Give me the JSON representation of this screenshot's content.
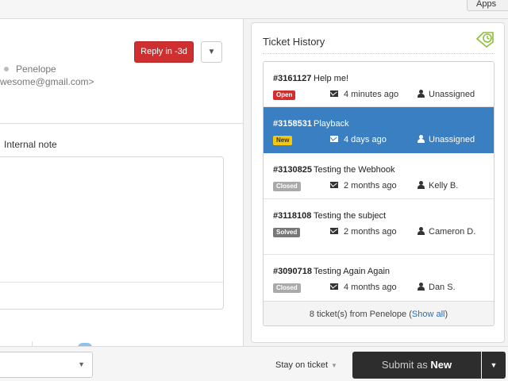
{
  "topbar": {
    "apps_label": "Apps"
  },
  "main": {
    "reply_button": "Reply in -3d",
    "reply_menu_icon": "chevron-down-icon",
    "requester_name": "Penelope",
    "requester_email": "wesome@gmail.com>",
    "internal_note_label": "Internal note"
  },
  "history": {
    "title": "Ticket History",
    "icon": "clock-tag-icon",
    "tickets": [
      {
        "number": "#3161127",
        "subject": "Help me!",
        "status": "Open",
        "time": "4 minutes ago",
        "assignee": "Unassigned"
      },
      {
        "number": "#3158531",
        "subject": "Playback",
        "status": "New",
        "time": "4 days ago",
        "assignee": "Unassigned"
      },
      {
        "number": "#3130825",
        "subject": "Testing the Webhook",
        "status": "Closed",
        "time": "2 months ago",
        "assignee": "Kelly B."
      },
      {
        "number": "#3118108",
        "subject": "Testing the subject",
        "status": "Solved",
        "time": "2 months ago",
        "assignee": "Cameron D."
      },
      {
        "number": "#3090718",
        "subject": "Testing Again Again",
        "status": "Closed",
        "time": "4 months ago",
        "assignee": "Dan S."
      }
    ],
    "footer_prefix": "8 ticket(s) from Penelope (",
    "footer_link": "Show all",
    "footer_suffix": ")"
  },
  "bottom": {
    "stay_label": "Stay on ticket",
    "submit_prefix": "Submit as",
    "submit_status": "New"
  },
  "colors": {
    "open": "#d02f2f",
    "new": "#f5c90a",
    "closed": "#aaaaaa",
    "solved": "#777777",
    "selected_row": "#3a7fc1",
    "reply": "#d02f2f"
  }
}
